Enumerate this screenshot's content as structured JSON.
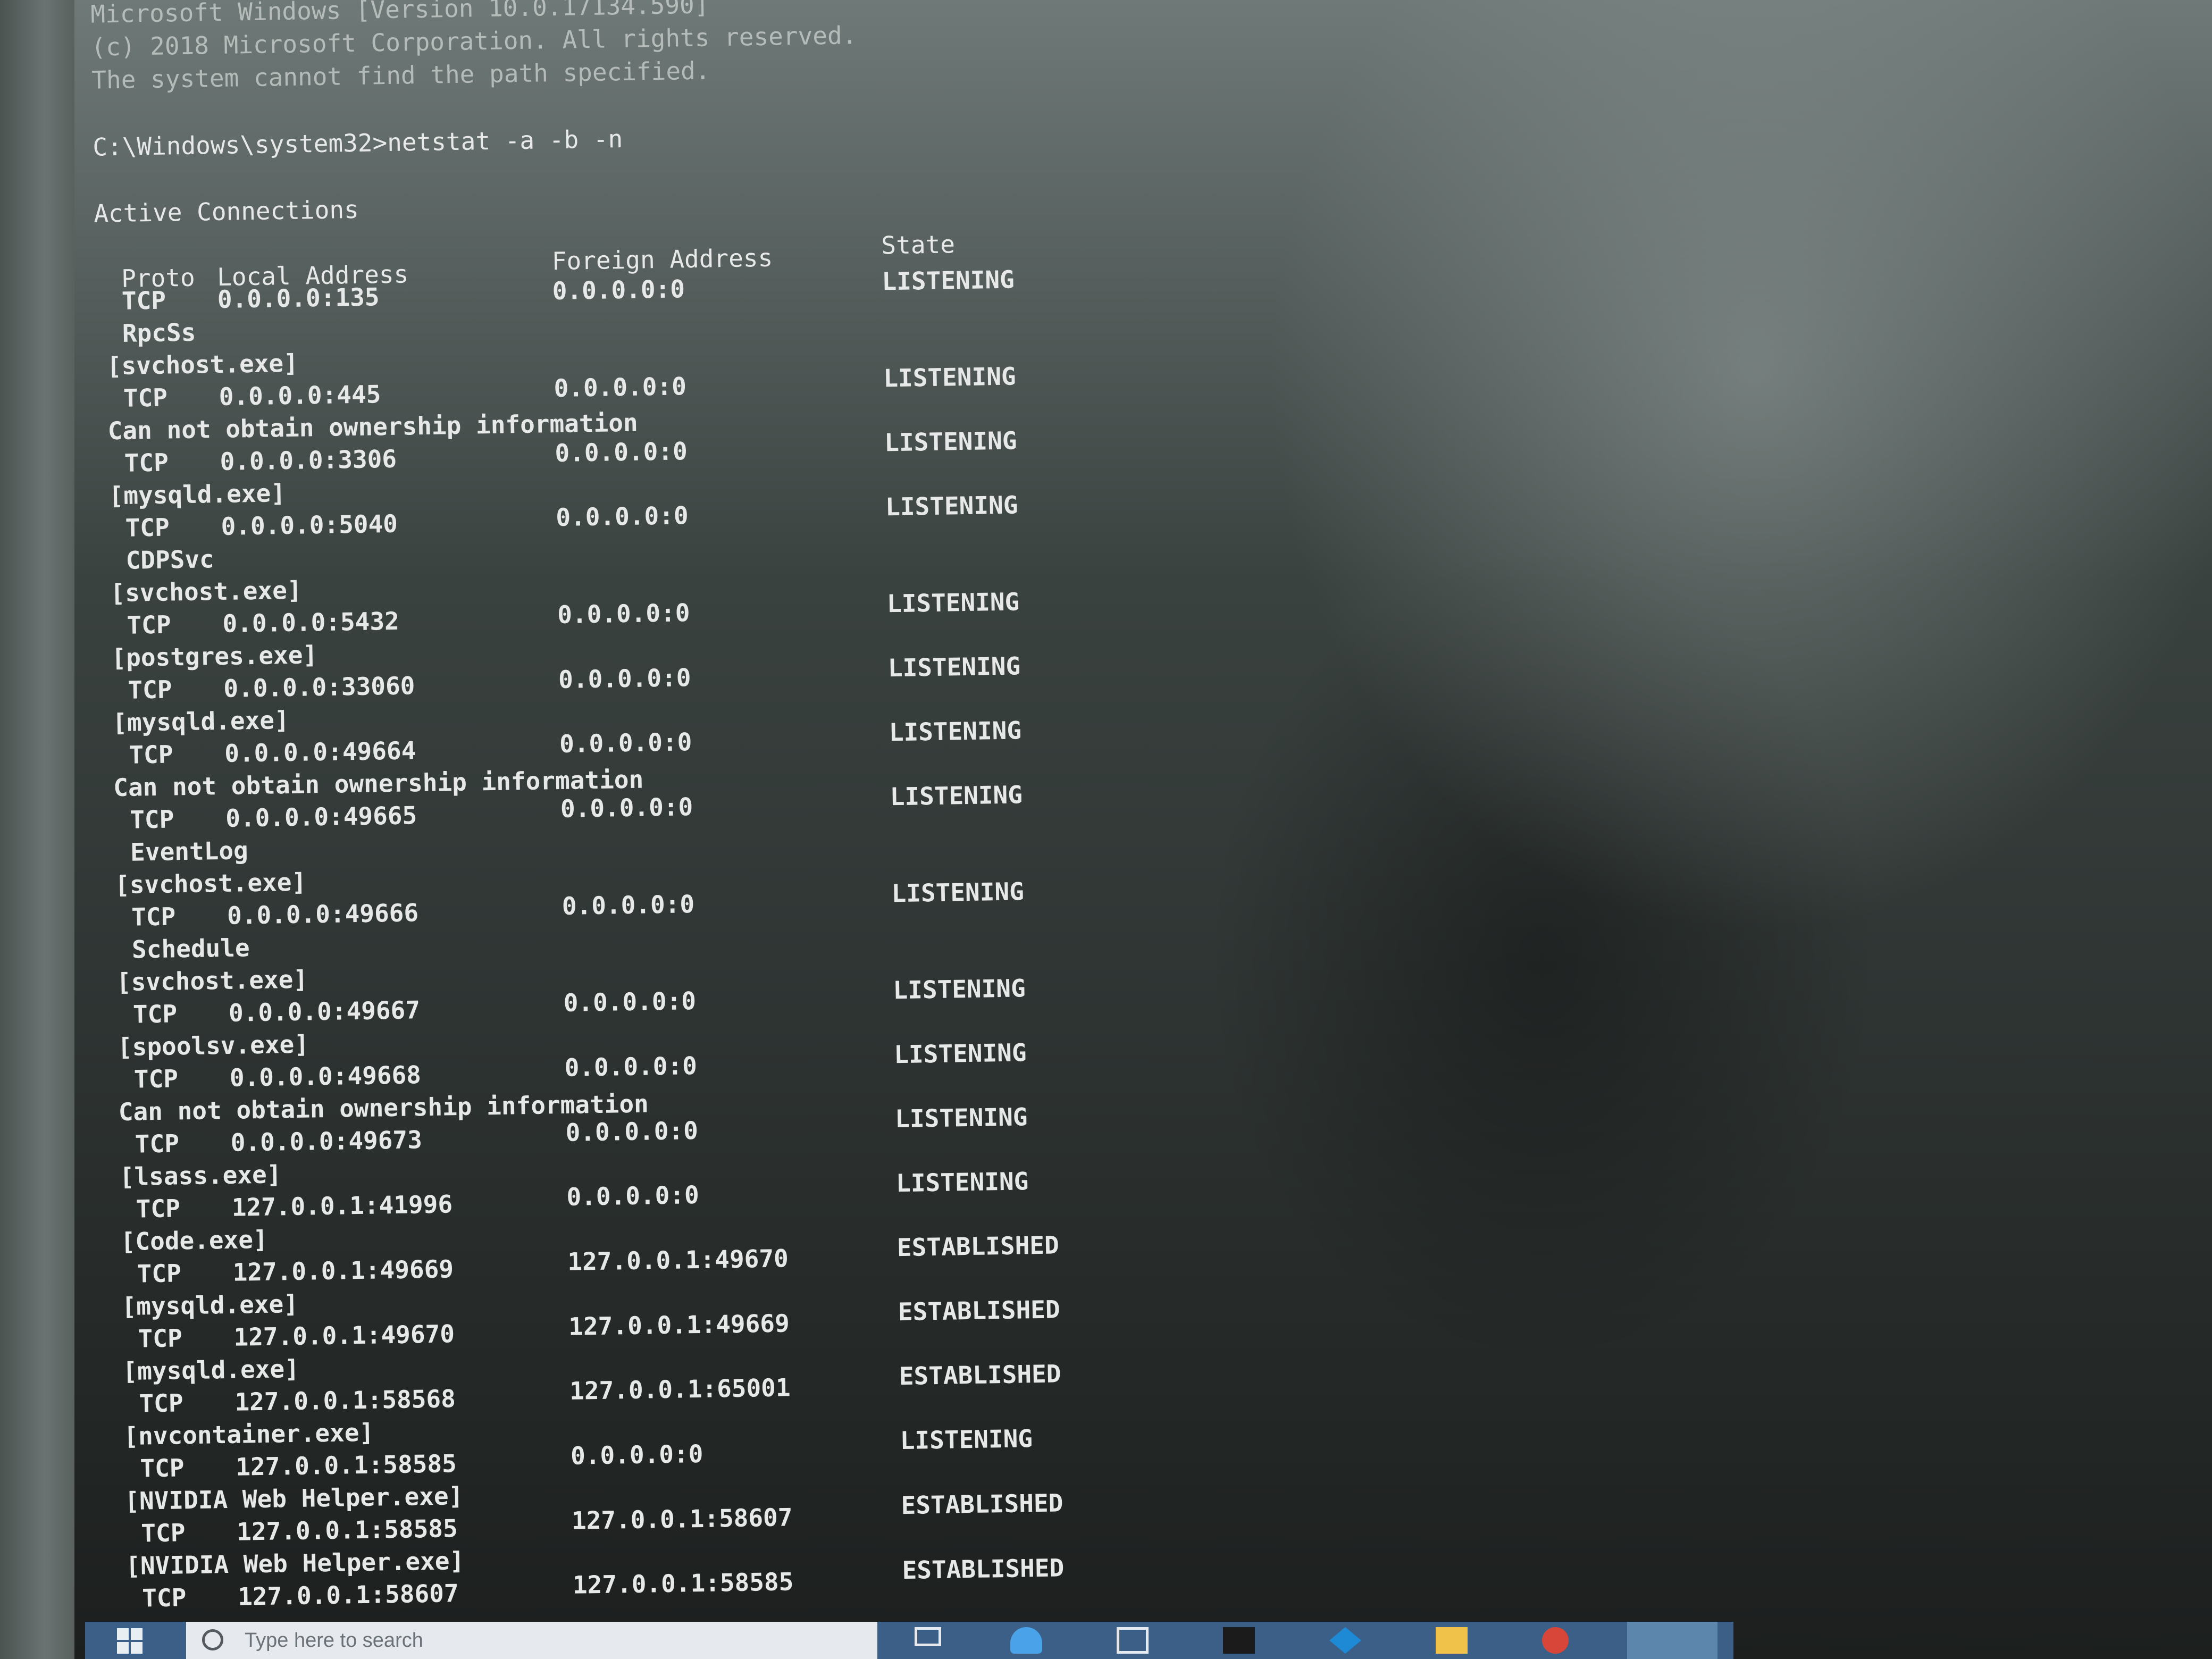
{
  "terminal": {
    "header_lines": [
      "Microsoft Windows [Version 10.0.17134.590]",
      "(c) 2018 Microsoft Corporation. All rights reserved.",
      "The system cannot find the path specified."
    ],
    "prompt": "C:\\Windows\\system32>netstat -a -b -n",
    "section_title": "Active Connections",
    "columns": {
      "proto": "Proto",
      "local": "Local Address",
      "foreign": "Foreign Address",
      "state": "State"
    },
    "entries": [
      {
        "proto": "TCP",
        "local": "0.0.0.0:135",
        "foreign": "0.0.0.0:0",
        "state": "LISTENING",
        "owner_lines": [
          "RpcSs",
          "[svchost.exe]"
        ]
      },
      {
        "proto": "TCP",
        "local": "0.0.0.0:445",
        "foreign": "0.0.0.0:0",
        "state": "LISTENING",
        "owner_lines": [
          "Can not obtain ownership information"
        ]
      },
      {
        "proto": "TCP",
        "local": "0.0.0.0:3306",
        "foreign": "0.0.0.0:0",
        "state": "LISTENING",
        "owner_lines": [
          "[mysqld.exe]"
        ]
      },
      {
        "proto": "TCP",
        "local": "0.0.0.0:5040",
        "foreign": "0.0.0.0:0",
        "state": "LISTENING",
        "owner_lines": [
          "CDPSvc",
          "[svchost.exe]"
        ]
      },
      {
        "proto": "TCP",
        "local": "0.0.0.0:5432",
        "foreign": "0.0.0.0:0",
        "state": "LISTENING",
        "owner_lines": [
          "[postgres.exe]"
        ]
      },
      {
        "proto": "TCP",
        "local": "0.0.0.0:33060",
        "foreign": "0.0.0.0:0",
        "state": "LISTENING",
        "owner_lines": [
          "[mysqld.exe]"
        ]
      },
      {
        "proto": "TCP",
        "local": "0.0.0.0:49664",
        "foreign": "0.0.0.0:0",
        "state": "LISTENING",
        "owner_lines": [
          "Can not obtain ownership information"
        ]
      },
      {
        "proto": "TCP",
        "local": "0.0.0.0:49665",
        "foreign": "0.0.0.0:0",
        "state": "LISTENING",
        "owner_lines": [
          "EventLog",
          "[svchost.exe]"
        ]
      },
      {
        "proto": "TCP",
        "local": "0.0.0.0:49666",
        "foreign": "0.0.0.0:0",
        "state": "LISTENING",
        "owner_lines": [
          "Schedule",
          "[svchost.exe]"
        ]
      },
      {
        "proto": "TCP",
        "local": "0.0.0.0:49667",
        "foreign": "0.0.0.0:0",
        "state": "LISTENING",
        "owner_lines": [
          "[spoolsv.exe]"
        ]
      },
      {
        "proto": "TCP",
        "local": "0.0.0.0:49668",
        "foreign": "0.0.0.0:0",
        "state": "LISTENING",
        "owner_lines": [
          "Can not obtain ownership information"
        ]
      },
      {
        "proto": "TCP",
        "local": "0.0.0.0:49673",
        "foreign": "0.0.0.0:0",
        "state": "LISTENING",
        "owner_lines": [
          "[lsass.exe]"
        ]
      },
      {
        "proto": "TCP",
        "local": "127.0.0.1:41996",
        "foreign": "0.0.0.0:0",
        "state": "LISTENING",
        "owner_lines": [
          "[Code.exe]"
        ]
      },
      {
        "proto": "TCP",
        "local": "127.0.0.1:49669",
        "foreign": "127.0.0.1:49670",
        "state": "ESTABLISHED",
        "owner_lines": [
          "[mysqld.exe]"
        ]
      },
      {
        "proto": "TCP",
        "local": "127.0.0.1:49670",
        "foreign": "127.0.0.1:49669",
        "state": "ESTABLISHED",
        "owner_lines": [
          "[mysqld.exe]"
        ]
      },
      {
        "proto": "TCP",
        "local": "127.0.0.1:58568",
        "foreign": "127.0.0.1:65001",
        "state": "ESTABLISHED",
        "owner_lines": [
          "[nvcontainer.exe]"
        ]
      },
      {
        "proto": "TCP",
        "local": "127.0.0.1:58585",
        "foreign": "0.0.0.0:0",
        "state": "LISTENING",
        "owner_lines": [
          "[NVIDIA Web Helper.exe]"
        ]
      },
      {
        "proto": "TCP",
        "local": "127.0.0.1:58585",
        "foreign": "127.0.0.1:58607",
        "state": "ESTABLISHED",
        "owner_lines": [
          "[NVIDIA Web Helper.exe]"
        ]
      },
      {
        "proto": "TCP",
        "local": "127.0.0.1:58607",
        "foreign": "127.0.0.1:58585",
        "state": "ESTABLISHED",
        "owner_lines": []
      }
    ]
  },
  "taskbar": {
    "search_placeholder": "Type here to search",
    "icons": [
      "windows-start-icon",
      "search-icon",
      "task-view-icon",
      "edge-icon",
      "store-icon",
      "app-icon",
      "vscode-icon",
      "file-explorer-icon",
      "chrome-icon"
    ]
  },
  "colors": {
    "terminal_text": "#e6e9e8",
    "taskbar": "#3b5f86"
  }
}
